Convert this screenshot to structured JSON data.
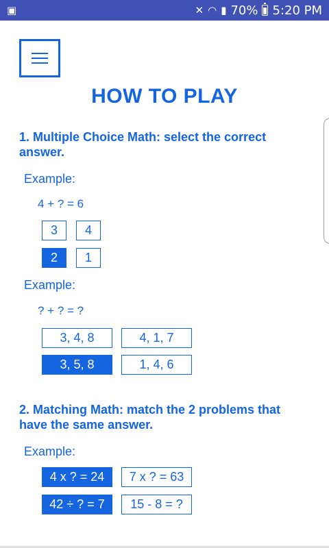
{
  "status_bar": {
    "left_icon": "notification-icon",
    "battery_percent": "70%",
    "time": "5:20 PM",
    "icons": [
      "mute-icon",
      "wifi-icon",
      "signal-icon",
      "battery-icon"
    ]
  },
  "menu": {
    "icon": "hamburger-menu-icon"
  },
  "title": "HOW TO PLAY",
  "section1": {
    "heading": "1. Multiple Choice Math: select the correct answer.",
    "example1": {
      "label": "Example:",
      "equation": "4 + ? = 6",
      "options": [
        {
          "text": "3",
          "selected": false
        },
        {
          "text": "4",
          "selected": false
        },
        {
          "text": "2",
          "selected": true
        },
        {
          "text": "1",
          "selected": false
        }
      ]
    },
    "example2": {
      "label": "Example:",
      "equation": "? + ? = ?",
      "options": [
        {
          "text": "3, 4, 8",
          "selected": false
        },
        {
          "text": "4, 1, 7",
          "selected": false
        },
        {
          "text": "3, 5, 8",
          "selected": true
        },
        {
          "text": "1, 4, 6",
          "selected": false
        }
      ]
    }
  },
  "section2": {
    "heading": "2. Matching Math: match the 2 problems that have the same answer.",
    "example": {
      "label": "Example:",
      "options": [
        {
          "text": "4 x ? = 24",
          "selected": true
        },
        {
          "text": "7 x ? = 63",
          "selected": false
        },
        {
          "text": "42 ÷ ? = 7",
          "selected": true
        },
        {
          "text": "15 - 8 = ?",
          "selected": false
        }
      ]
    }
  },
  "colors": {
    "accent": "#1565e0",
    "status_bar": "#3f51b5",
    "background": "#ffffff"
  }
}
